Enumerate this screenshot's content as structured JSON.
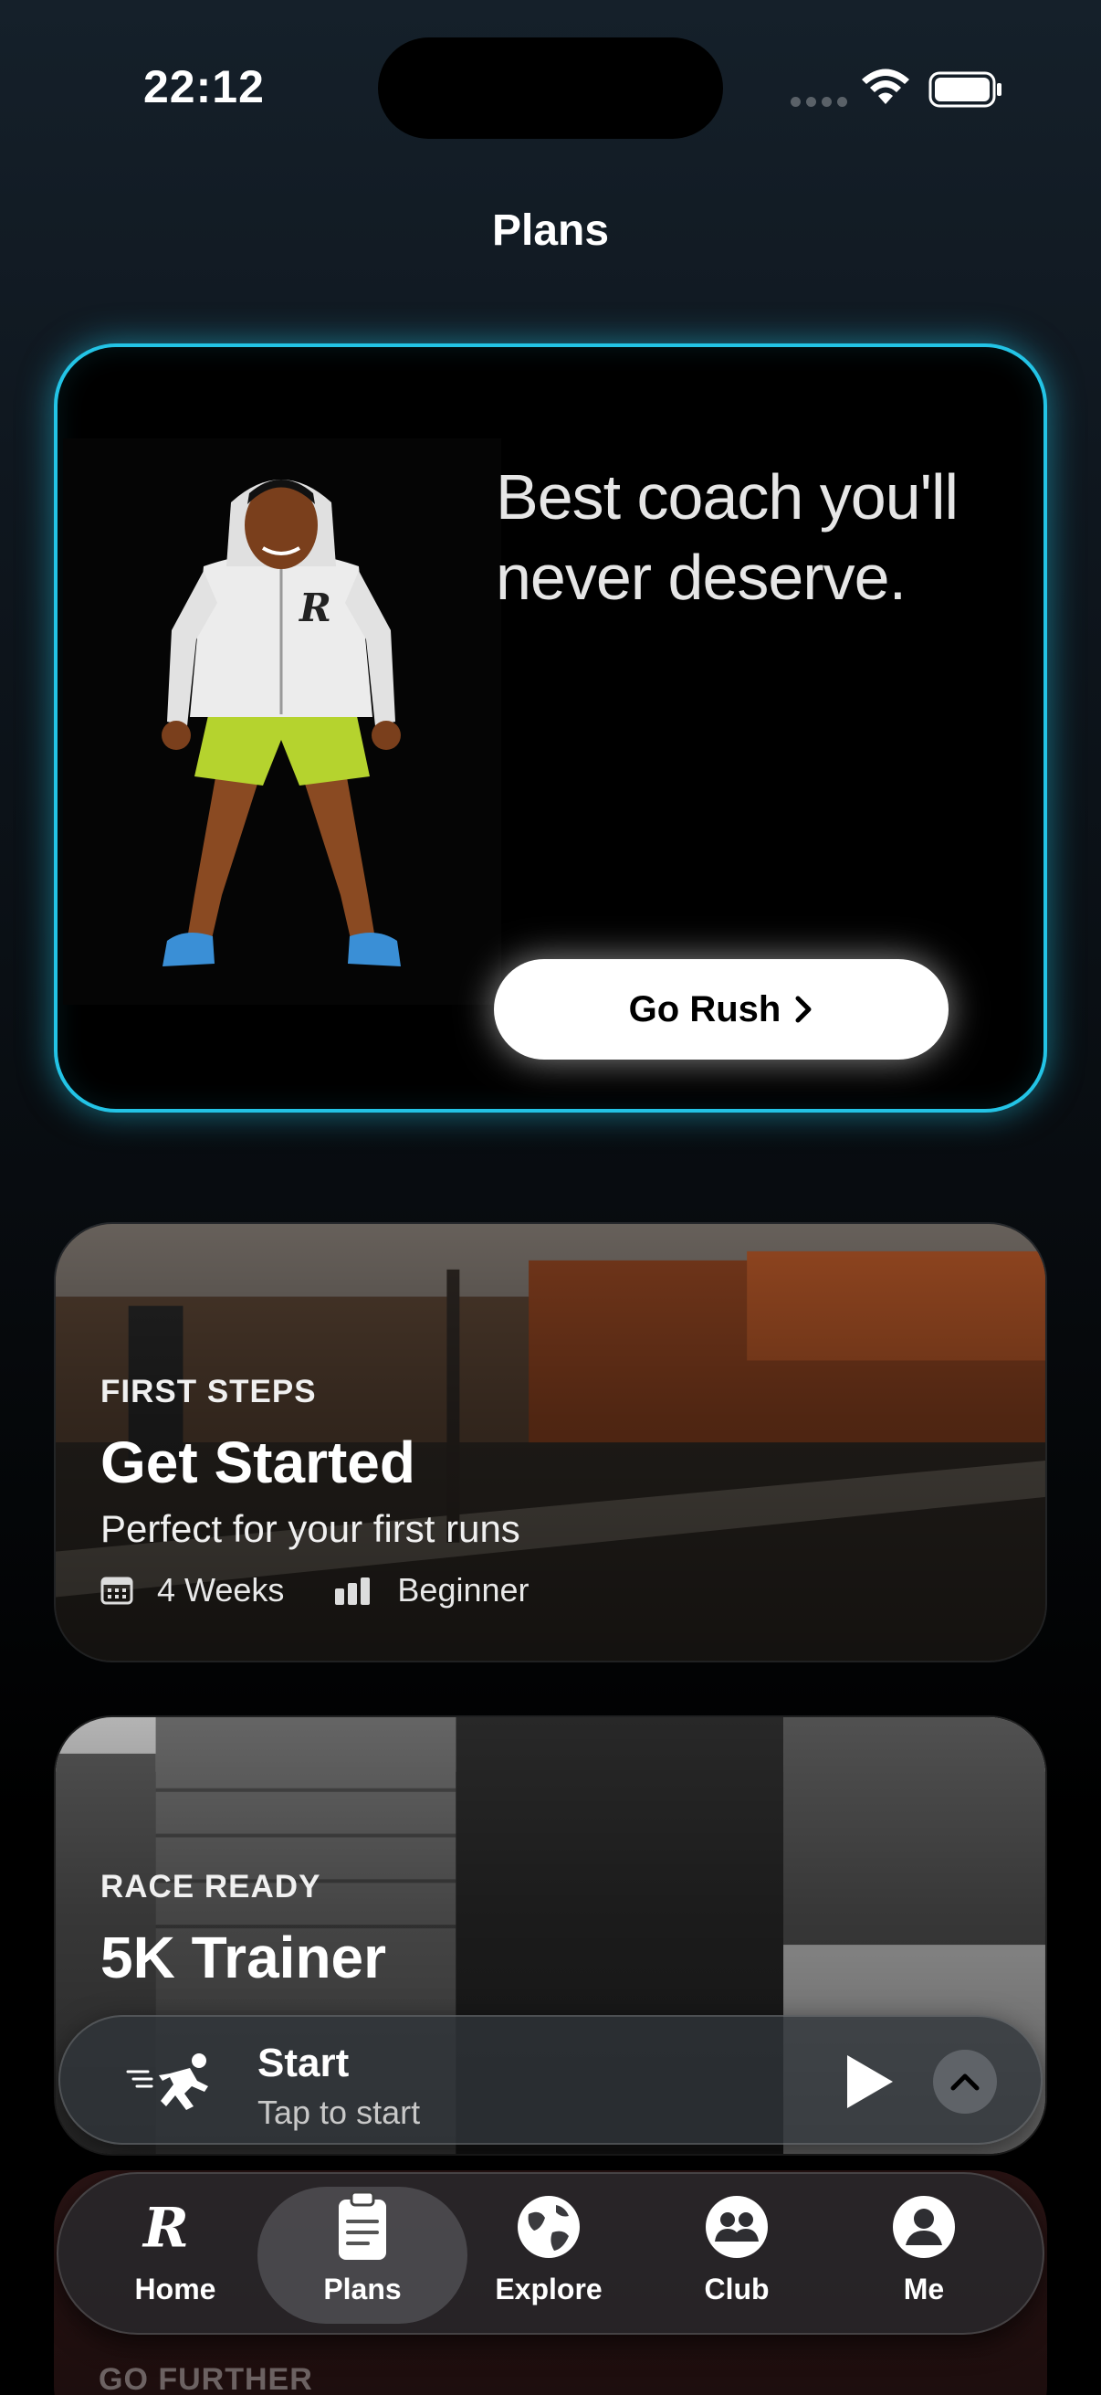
{
  "status_bar": {
    "time": "22:12"
  },
  "header": {
    "title": "Plans"
  },
  "hero": {
    "tagline": "Best coach you'll never deserve.",
    "button_label": "Go Rush",
    "accent_color": "#23c4e6",
    "illustration": "coach-illustration"
  },
  "plans": [
    {
      "eyebrow": "FIRST STEPS",
      "title": "Get Started",
      "subtitle": "Perfect for your first runs",
      "duration": "4 Weeks",
      "level": "Beginner"
    },
    {
      "eyebrow": "RACE READY",
      "title": "5K Trainer"
    },
    {
      "eyebrow": "GO FURTHER"
    }
  ],
  "now_playing": {
    "title": "Start",
    "subtitle": "Tap to start",
    "icon": "runner-icon"
  },
  "tab_bar": {
    "items": [
      {
        "label": "Home",
        "icon": "logo-r-icon"
      },
      {
        "label": "Plans",
        "icon": "clipboard-icon",
        "active": true
      },
      {
        "label": "Explore",
        "icon": "globe-icon"
      },
      {
        "label": "Club",
        "icon": "group-icon"
      },
      {
        "label": "Me",
        "icon": "person-icon"
      }
    ]
  }
}
